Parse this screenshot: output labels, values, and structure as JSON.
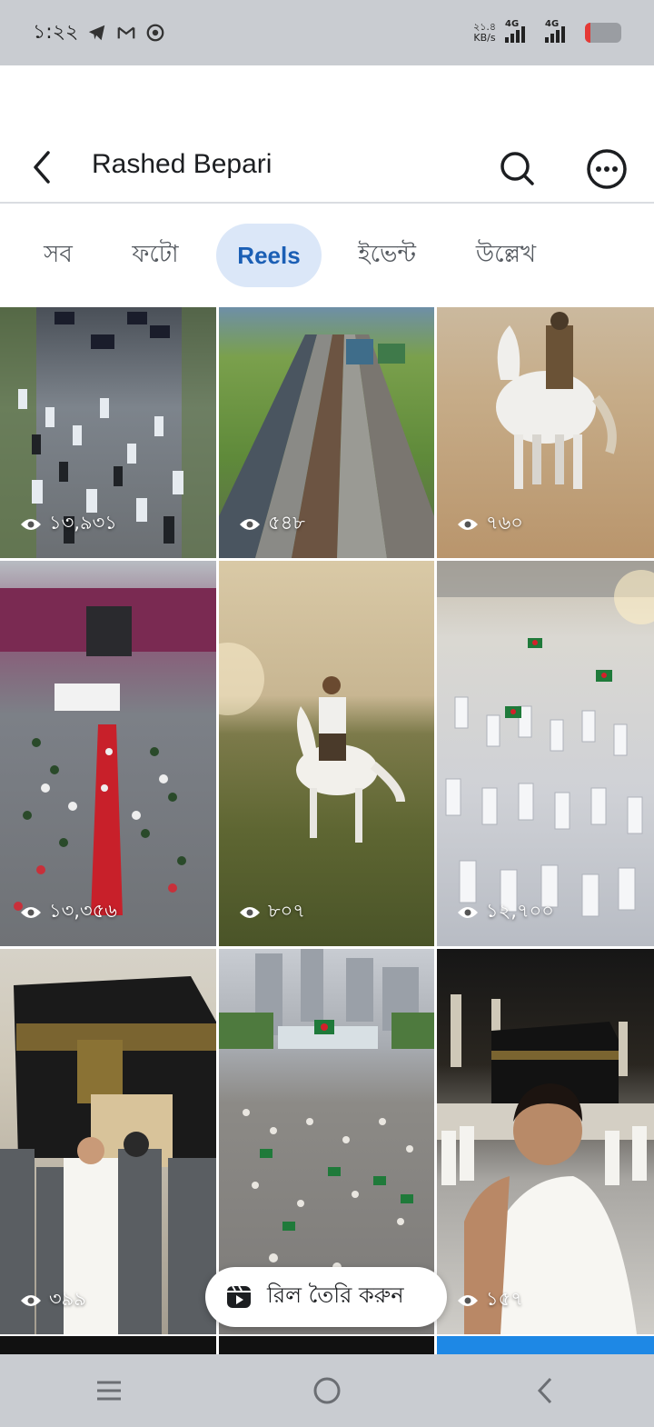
{
  "status_bar": {
    "time": "১:২২",
    "net_speed_value": "২১.৪",
    "net_speed_unit": "KB/s",
    "network1": "4G",
    "network2": "4G",
    "battery_level": 0.15,
    "battery_color": "#e53935",
    "icons": [
      "telegram-icon",
      "gmail-icon",
      "chrome-icon"
    ]
  },
  "header": {
    "title": "Rashed Bepari",
    "icons": [
      "back-arrow-icon",
      "search-icon",
      "more-options-icon"
    ]
  },
  "tabs": [
    {
      "label": "সব",
      "active": false
    },
    {
      "label": "ফটো",
      "active": false
    },
    {
      "label": "Reels",
      "active": true
    },
    {
      "label": "ইভেন্ট",
      "active": false
    },
    {
      "label": "উল্লেখ",
      "active": false
    }
  ],
  "reels": [
    {
      "views": "১৩,৯৩১",
      "subject": "procession-crowd"
    },
    {
      "views": "৫৪৮",
      "subject": "railway-tracks"
    },
    {
      "views": "৭৬০",
      "subject": "rider-white-horse-desert"
    },
    {
      "views": "১৩,৩৫৬",
      "subject": "stadium-red-carpet"
    },
    {
      "views": "৮০৭",
      "subject": "rider-white-horse-field"
    },
    {
      "views": "১২,৭০০",
      "subject": "crowd-white-clothes-flags"
    },
    {
      "views": "৩৯৯",
      "subject": "kaaba-guards"
    },
    {
      "views": "",
      "subject": "square-crowd-flags"
    },
    {
      "views": "১৫৭",
      "subject": "man-ihram-kaaba"
    }
  ],
  "create_reel": {
    "label": "রিল তৈরি করুন"
  },
  "colors": {
    "accent": "#1b5fb5",
    "tab_active_bg": "#dbe7f8",
    "system_bar": "#c9ccd1"
  }
}
